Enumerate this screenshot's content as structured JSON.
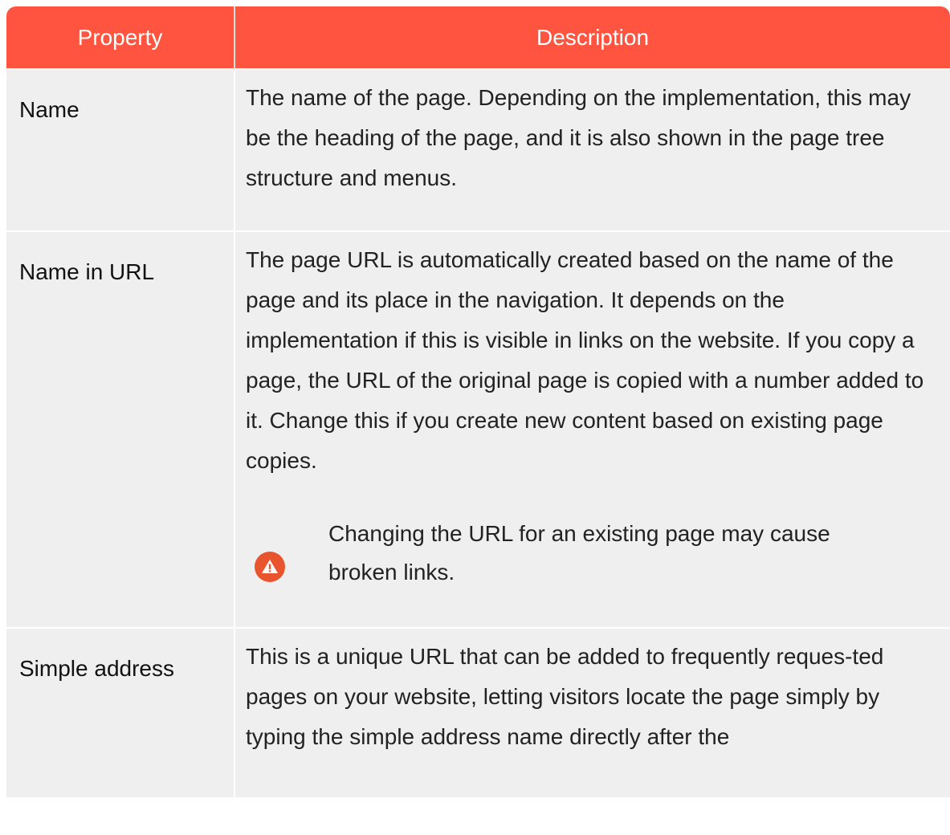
{
  "table": {
    "headers": [
      "Property",
      "Description"
    ],
    "rows": [
      {
        "property": "Name",
        "description": "The name of the page. Depending on the implementation, this may be the heading of the page, and it is also shown in the page tree structure and menus."
      },
      {
        "property": "Name in URL",
        "description": "The page URL is automatically created based on the name of the page and its place in the navigation. It depends on the implementation if this is visible in links on the website. If you copy a page, the URL of the original page is copied with a number added to it. Change this if you create new content based on existing page copies.",
        "note": {
          "icon": "warning-icon",
          "text": "Changing the URL for an existing page may cause broken links."
        }
      },
      {
        "property": "Simple address",
        "description": "This is a unique URL that can be added to frequently reques-ted pages on your website, letting visitors locate the page simply by typing the simple address name directly after the"
      }
    ]
  },
  "colors": {
    "header_bg": "#ff5440",
    "row_bg": "#efefef",
    "warning_icon": "#e8542e"
  }
}
